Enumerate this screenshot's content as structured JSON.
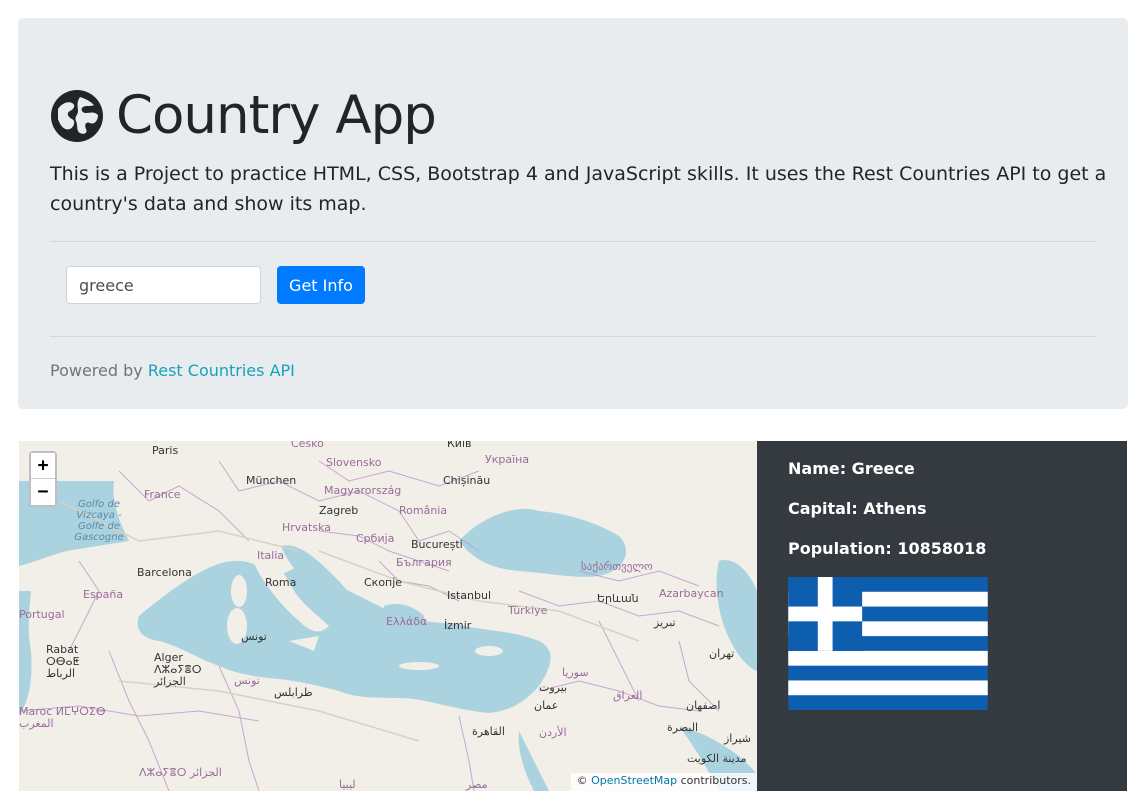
{
  "header": {
    "title": "Country App",
    "lead": "This is a Project to practice HTML, CSS, Bootstrap 4 and JavaScript skills. It uses the Rest Countries API to get a country's data and show its map.",
    "search_value": "greece",
    "button_label": "Get Info",
    "powered_prefix": "Powered by ",
    "powered_link": "Rest Countries API"
  },
  "map": {
    "zoom_in": "+",
    "zoom_out": "−",
    "attribution_prefix": "© ",
    "attribution_link": "OpenStreetMap",
    "attribution_suffix": " contributors.",
    "labels": {
      "paris": "Paris",
      "cesko": "Česko",
      "kyiv": "Київ",
      "slovensko": "Slovensko",
      "ukraina": "Україна",
      "munchen": "München",
      "chisinau": "Chișinău",
      "france": "France",
      "magyarorszag": "Magyarország",
      "golfe": "Golfo de Vizcaya - Golfe de Gascogne",
      "zagreb": "Zagreb",
      "romania": "România",
      "hrvatska": "Hrvatska",
      "srbija": "Србија",
      "bucuresti": "București",
      "italia": "Italia",
      "bulgaria": "България",
      "sakartvelo": "საქართველო",
      "barcelona": "Barcelona",
      "roma": "Roma",
      "skopje": "Скопје",
      "espana": "España",
      "istanbul": "Istanbul",
      "yerevan": "Երևան",
      "azarbaycan": "Azarbaycan",
      "portugal": "Portugal",
      "turkiye": "Türkiye",
      "ellada": "Ελλάδα",
      "izmir": "İzmir",
      "tabriz": "تبریز",
      "tunis": "تونس",
      "rabat": "Rabat",
      "rabat_tif": "ⵔⴱⴰⵟ",
      "rabat_ar": "الرباط",
      "alger": "Alger",
      "alger_tif": "ⴷⵣⴰⵢⴻⵔ",
      "alger_ar": "الجزائر",
      "tunis2": "تونس",
      "beirut": "بيروت",
      "suria": "سوريا",
      "tehran": "تهران",
      "tarabulus": "طرابلس",
      "amman": "عمان",
      "iraq": "العراق",
      "isfahan": "اصفهان",
      "maroc": "Maroc ⵍⵎⵖⵔⵉⴱ",
      "maghrib": "المغرب",
      "cairo": "القاهرة",
      "urdun": "الأردن",
      "basra": "البصرة",
      "shiraz": "شیراز",
      "kuwait": "مدينة الكويت",
      "dzair": "ⴷⵣⴰⵢⴻⵔ الجزائر",
      "libya": "ليبيا",
      "misr": "مصر"
    }
  },
  "country": {
    "name": "Name: Greece",
    "capital": "Capital: Athens",
    "population": "Population: 10858018"
  },
  "colors": {
    "jumbotron_bg": "#e9ecef",
    "primary": "#007bff",
    "link": "#17a2b8",
    "info_bg": "#343a40",
    "flag_blue": "#0d5eaf",
    "sea": "#aad3df",
    "land": "#f2efe9"
  },
  "icons": {
    "globe": "globe-europe-icon"
  }
}
